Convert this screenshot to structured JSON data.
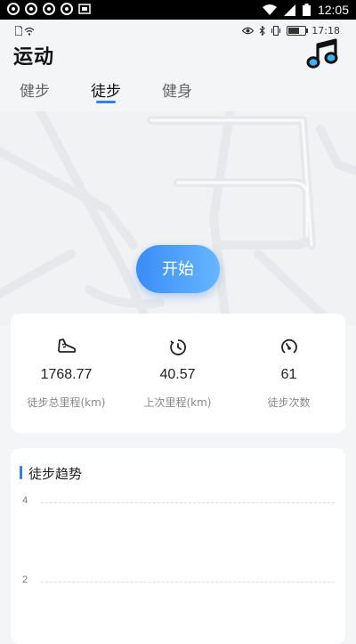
{
  "status_bar": {
    "time": "12:05",
    "left_icons": [
      "app-icon",
      "app-icon",
      "app-icon",
      "app-icon",
      "gallery-icon"
    ],
    "right_icons": [
      "wifi-icon",
      "signal-icon",
      "battery-icon"
    ]
  },
  "app_status": {
    "sim_icon": "sim-icon",
    "wifi_icon": "wifi-icon",
    "time": "17:18"
  },
  "header": {
    "title": "运动",
    "music_icon": "music-note-icon"
  },
  "tabs": [
    {
      "label": "健步",
      "active": false
    },
    {
      "label": "徒步",
      "active": true
    },
    {
      "label": "健身",
      "active": false
    }
  ],
  "start_button": {
    "label": "开始"
  },
  "stats": [
    {
      "icon": "shoe-icon",
      "value": "1768.77",
      "label": "徒步总里程(km)"
    },
    {
      "icon": "timer-icon",
      "value": "40.57",
      "label": "上次里程(km)"
    },
    {
      "icon": "speedometer-icon",
      "value": "61",
      "label": "徒步次数"
    }
  ],
  "trend": {
    "title": "徒步趋势",
    "y_ticks": [
      "4",
      "2"
    ]
  },
  "colors": {
    "accent": "#2f80ed",
    "background": "#f4f5f7",
    "card": "#ffffff"
  }
}
